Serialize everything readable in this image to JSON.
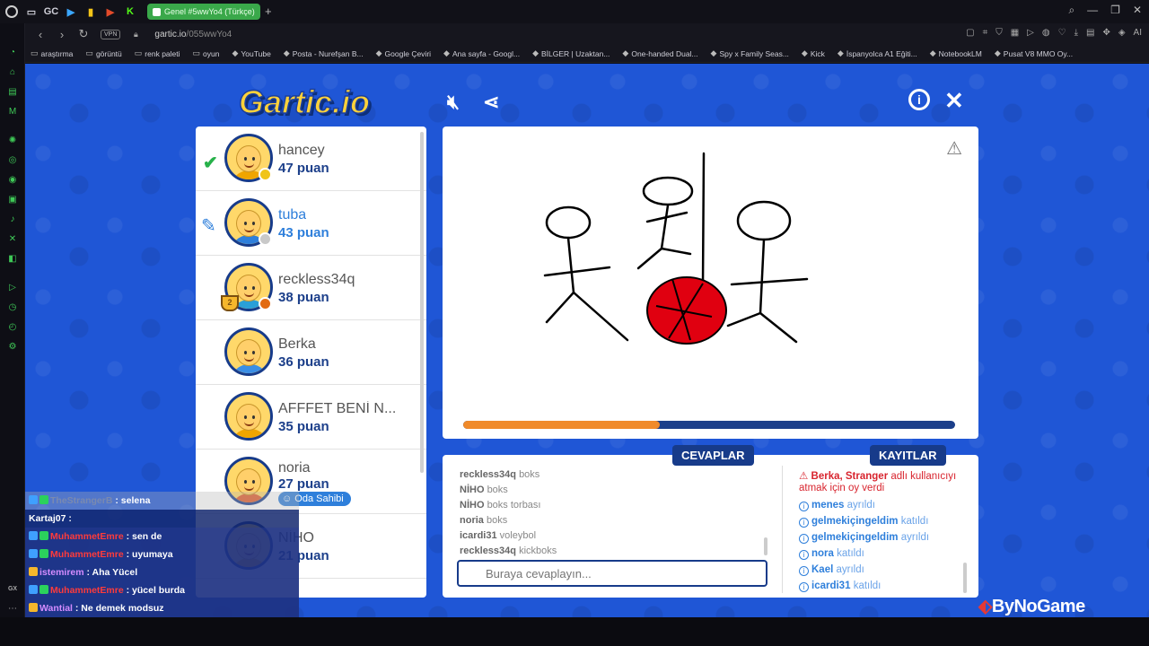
{
  "browser": {
    "active_tab_title": "Genel #5wwYo4 (Türkçe)",
    "url_host": "gartic.io",
    "url_path": "/055wwYo4",
    "vpn_label": "VPN",
    "ai_label": "AI",
    "tab_icons": [
      "GC"
    ],
    "bookmarks": [
      "araştırma",
      "görüntü",
      "renk paleti",
      "oyun",
      "YouTube",
      "Posta - Nurefşan B...",
      "Google Çeviri",
      "Ana sayfa - Googl...",
      "BİLGER | Uzaktan...",
      "One-handed Dual...",
      "Spy x Family Seas...",
      "Kick",
      "İspanyolca A1 Eğiti...",
      "NotebookLM",
      "Pusat V8 MMO Oy..."
    ],
    "sidebar_bottom_label": "GX"
  },
  "game": {
    "logo_text": "Gartic.io",
    "players": [
      {
        "name": "hancey",
        "score": "47 puan",
        "shirt": "#f0a500",
        "status": "#f0c419"
      },
      {
        "name": "tuba",
        "score": "43 puan",
        "shirt": "#2e7fdb",
        "status": "#c9c9c9"
      },
      {
        "name": "reckless34q",
        "score": "38 puan",
        "shirt": "#2a9fd8",
        "status": "#e26b12",
        "trophy": "2"
      },
      {
        "name": "Berka",
        "score": "36 puan",
        "shirt": "#3a8ee6"
      },
      {
        "name": "AFFFET BENİ N...",
        "score": "35 puan",
        "shirt": "#f0a500"
      },
      {
        "name": "noria",
        "score": "27 puan",
        "shirt": "#e05a2a",
        "badge": "Oda Sahibi"
      },
      {
        "name": "NİHO",
        "score": "21 puan",
        "shirt": "#f0a500"
      }
    ],
    "progress": 0.4,
    "tabs": {
      "answers": "CEVAPLAR",
      "logs": "KAYITLAR"
    },
    "answers": [
      {
        "user": "reckless34q",
        "text": "boks"
      },
      {
        "user": "NİHO",
        "text": "boks"
      },
      {
        "user": "NİHO",
        "text": "boks torbası"
      },
      {
        "user": "noria",
        "text": "boks"
      },
      {
        "user": "icardi31",
        "text": "voleybol"
      },
      {
        "user": "reckless34q",
        "text": "kickboks"
      }
    ],
    "input_placeholder": "Buraya cevaplayın...",
    "vote_log": {
      "users": "Berka, Stranger",
      "text": "adlı kullanıcıyı atmak için oy verdi"
    },
    "logs": [
      {
        "user": "menes",
        "action": "ayrıldı"
      },
      {
        "user": "gelmekiçingeldim",
        "action": "katıldı"
      },
      {
        "user": "gelmekiçingeldim",
        "action": "ayrıldı"
      },
      {
        "user": "nora",
        "action": "katıldı"
      },
      {
        "user": "Kael",
        "action": "ayrıldı"
      },
      {
        "user": "icardi31",
        "action": "katıldı"
      }
    ],
    "brand": "ByNoGame"
  },
  "chat": [
    {
      "user": "TheStrangerB",
      "msg": ": selena",
      "cls": "usr-dim"
    },
    {
      "user": "Kartaj07",
      "msg": ":",
      "cls": "usr-white"
    },
    {
      "user": "MuhammetEmre",
      "msg": ": sen de",
      "cls": "usr-red"
    },
    {
      "user": "MuhammetEmre",
      "msg": ": uyumaya",
      "cls": "usr-red"
    },
    {
      "user": "istemirem",
      "msg": ": Aha Yücel",
      "cls": "usr-purple"
    },
    {
      "user": "MuhammetEmre",
      "msg": ": yücel burda",
      "cls": "usr-red"
    },
    {
      "user": "Wantial",
      "msg": ": Ne demek modsuz",
      "cls": "usr-purple"
    }
  ]
}
